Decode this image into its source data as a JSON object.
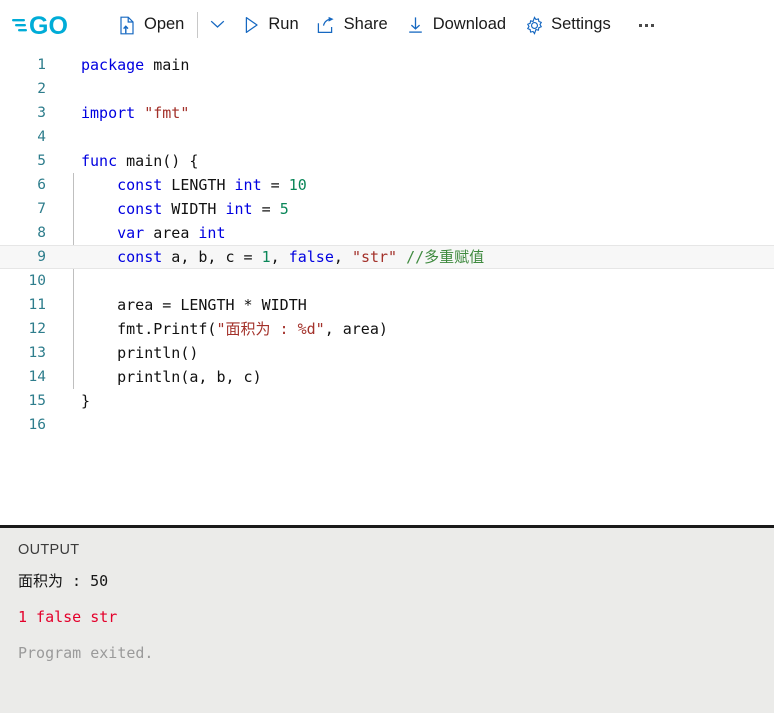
{
  "toolbar": {
    "logo_name": "go-logo",
    "logo_text": "GO",
    "logo_color": "#00acd7",
    "items": [
      {
        "id": "open",
        "label": "Open",
        "icon": "open-file-icon"
      },
      {
        "id": "run",
        "label": "Run",
        "icon": "play-icon"
      },
      {
        "id": "share",
        "label": "Share",
        "icon": "share-icon"
      },
      {
        "id": "download",
        "label": "Download",
        "icon": "download-icon"
      },
      {
        "id": "settings",
        "label": "Settings",
        "icon": "gear-icon"
      }
    ],
    "caret_icon": "chevron-down-icon",
    "more_icon": "ellipsis-icon",
    "icon_color": "#1668c1"
  },
  "editor": {
    "language": "go",
    "active_line": 9,
    "line_numbers": [
      1,
      2,
      3,
      4,
      5,
      6,
      7,
      8,
      9,
      10,
      11,
      12,
      13,
      14,
      15,
      16
    ],
    "lines": [
      {
        "n": 1,
        "tokens": [
          {
            "t": "kw",
            "v": "package"
          },
          {
            "t": "pl",
            "v": " main"
          }
        ]
      },
      {
        "n": 2,
        "tokens": []
      },
      {
        "n": 3,
        "tokens": [
          {
            "t": "kw",
            "v": "import"
          },
          {
            "t": "pl",
            "v": " "
          },
          {
            "t": "str",
            "v": "\"fmt\""
          }
        ]
      },
      {
        "n": 4,
        "tokens": []
      },
      {
        "n": 5,
        "tokens": [
          {
            "t": "kw",
            "v": "func"
          },
          {
            "t": "pl",
            "v": " main() {"
          }
        ]
      },
      {
        "n": 6,
        "tokens": [
          {
            "t": "pl",
            "v": "    "
          },
          {
            "t": "kw",
            "v": "const"
          },
          {
            "t": "pl",
            "v": " LENGTH "
          },
          {
            "t": "kw",
            "v": "int"
          },
          {
            "t": "pl",
            "v": " = "
          },
          {
            "t": "num",
            "v": "10"
          }
        ]
      },
      {
        "n": 7,
        "tokens": [
          {
            "t": "pl",
            "v": "    "
          },
          {
            "t": "kw",
            "v": "const"
          },
          {
            "t": "pl",
            "v": " WIDTH "
          },
          {
            "t": "kw",
            "v": "int"
          },
          {
            "t": "pl",
            "v": " = "
          },
          {
            "t": "num",
            "v": "5"
          }
        ]
      },
      {
        "n": 8,
        "tokens": [
          {
            "t": "pl",
            "v": "    "
          },
          {
            "t": "kw",
            "v": "var"
          },
          {
            "t": "pl",
            "v": " area "
          },
          {
            "t": "kw",
            "v": "int"
          }
        ]
      },
      {
        "n": 9,
        "tokens": [
          {
            "t": "pl",
            "v": "    "
          },
          {
            "t": "kw",
            "v": "const"
          },
          {
            "t": "pl",
            "v": " a, b, c = "
          },
          {
            "t": "num",
            "v": "1"
          },
          {
            "t": "pl",
            "v": ", "
          },
          {
            "t": "kw",
            "v": "false"
          },
          {
            "t": "pl",
            "v": ", "
          },
          {
            "t": "str",
            "v": "\"str\""
          },
          {
            "t": "pl",
            "v": " "
          },
          {
            "t": "cmt",
            "v": "//多重赋值"
          }
        ]
      },
      {
        "n": 10,
        "tokens": []
      },
      {
        "n": 11,
        "tokens": [
          {
            "t": "pl",
            "v": "    area = LENGTH * WIDTH"
          }
        ]
      },
      {
        "n": 12,
        "tokens": [
          {
            "t": "pl",
            "v": "    fmt.Printf("
          },
          {
            "t": "str",
            "v": "\"面积为 : %d\""
          },
          {
            "t": "pl",
            "v": ", area)"
          }
        ]
      },
      {
        "n": 13,
        "tokens": [
          {
            "t": "pl",
            "v": "    println()"
          }
        ]
      },
      {
        "n": 14,
        "tokens": [
          {
            "t": "pl",
            "v": "    println(a, b, c)"
          }
        ]
      },
      {
        "n": 15,
        "tokens": [
          {
            "t": "pl",
            "v": "}"
          }
        ]
      },
      {
        "n": 16,
        "tokens": []
      }
    ],
    "colors": {
      "keyword": "#0000e0",
      "string": "#a3312a",
      "number": "#098658",
      "comment": "#3f8a3f",
      "plain": "#111111",
      "line_number": "#2e7d8c",
      "active_line_bg": "#f7f7f7"
    }
  },
  "output": {
    "title": "OUTPUT",
    "lines": [
      {
        "kind": "stdout",
        "text": "面积为 : 50"
      },
      {
        "kind": "stderr",
        "text": "1 false str"
      },
      {
        "kind": "exit",
        "text": "Program exited."
      }
    ],
    "colors": {
      "background": "#ebebe9",
      "stdout": "#161616",
      "stderr": "#e4002b",
      "exit": "#9a9a9a"
    }
  }
}
